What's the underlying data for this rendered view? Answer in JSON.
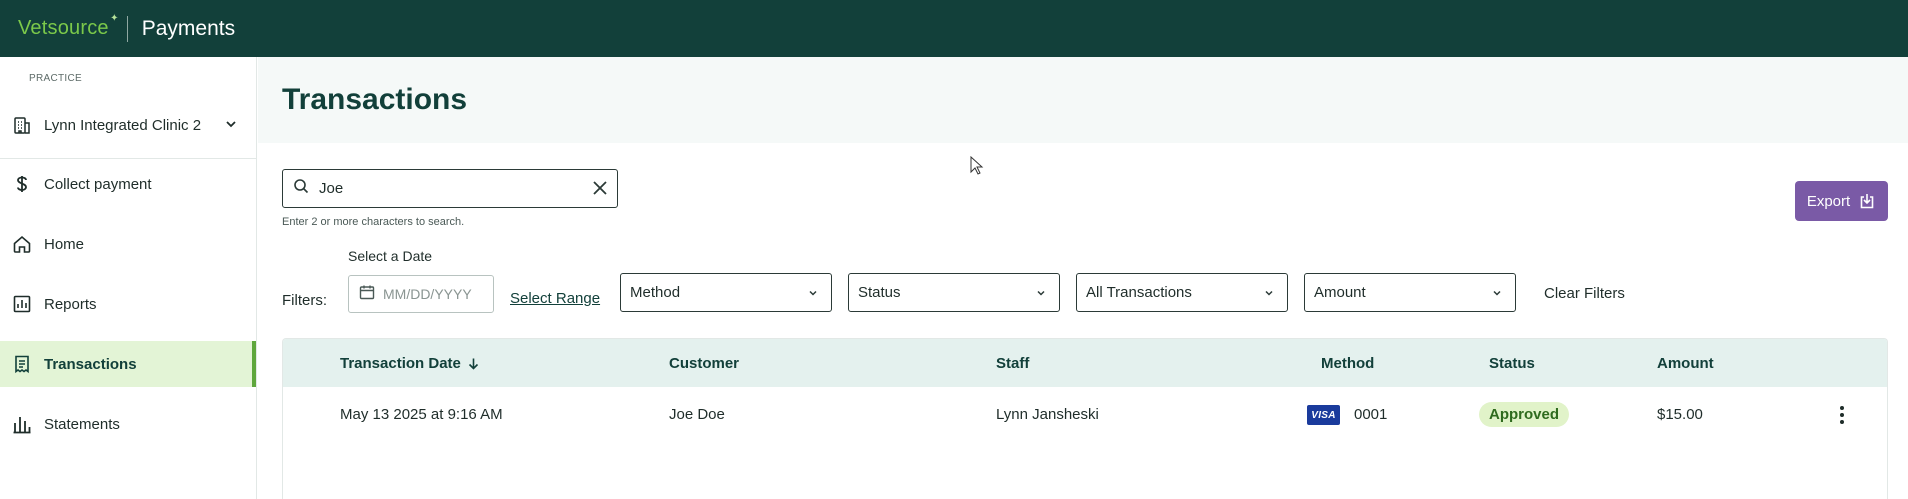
{
  "header": {
    "brand": "Vetsource",
    "app_name": "Payments"
  },
  "sidebar": {
    "practice_label": "PRACTICE",
    "practice_name": "Lynn Integrated Clinic 2",
    "items": [
      {
        "label": "Collect payment",
        "icon": "dollar-icon"
      },
      {
        "label": "Home",
        "icon": "home-icon"
      },
      {
        "label": "Reports",
        "icon": "reports-icon"
      },
      {
        "label": "Transactions",
        "icon": "receipt-icon",
        "active": true
      },
      {
        "label": "Statements",
        "icon": "bar-chart-icon"
      }
    ]
  },
  "main": {
    "title": "Transactions",
    "search": {
      "value": "Joe",
      "hint": "Enter 2 or more characters to search."
    },
    "export_label": "Export",
    "filters": {
      "label": "Filters:",
      "date_label": "Select a Date",
      "date_placeholder": "MM/DD/YYYY",
      "select_range": "Select Range",
      "method": "Method",
      "status": "Status",
      "transactions": "All Transactions",
      "amount": "Amount",
      "clear": "Clear Filters"
    },
    "table": {
      "columns": [
        "Transaction Date",
        "Customer",
        "Staff",
        "Method",
        "Status",
        "Amount"
      ],
      "rows": [
        {
          "date": "May 13 2025 at 9:16 AM",
          "customer": "Joe Doe",
          "staff": "Lynn Jansheski",
          "card_brand": "VISA",
          "card_last4": "0001",
          "status": "Approved",
          "amount": "$15.00"
        }
      ]
    }
  },
  "colors": {
    "header_bg": "#12403a",
    "brand_green": "#7bc94a",
    "active_nav_bg": "#e3f4d6",
    "export_purple": "#7a5aa6",
    "table_header_bg": "#e4f1ee",
    "approved_badge_bg": "#e1f3c9"
  }
}
